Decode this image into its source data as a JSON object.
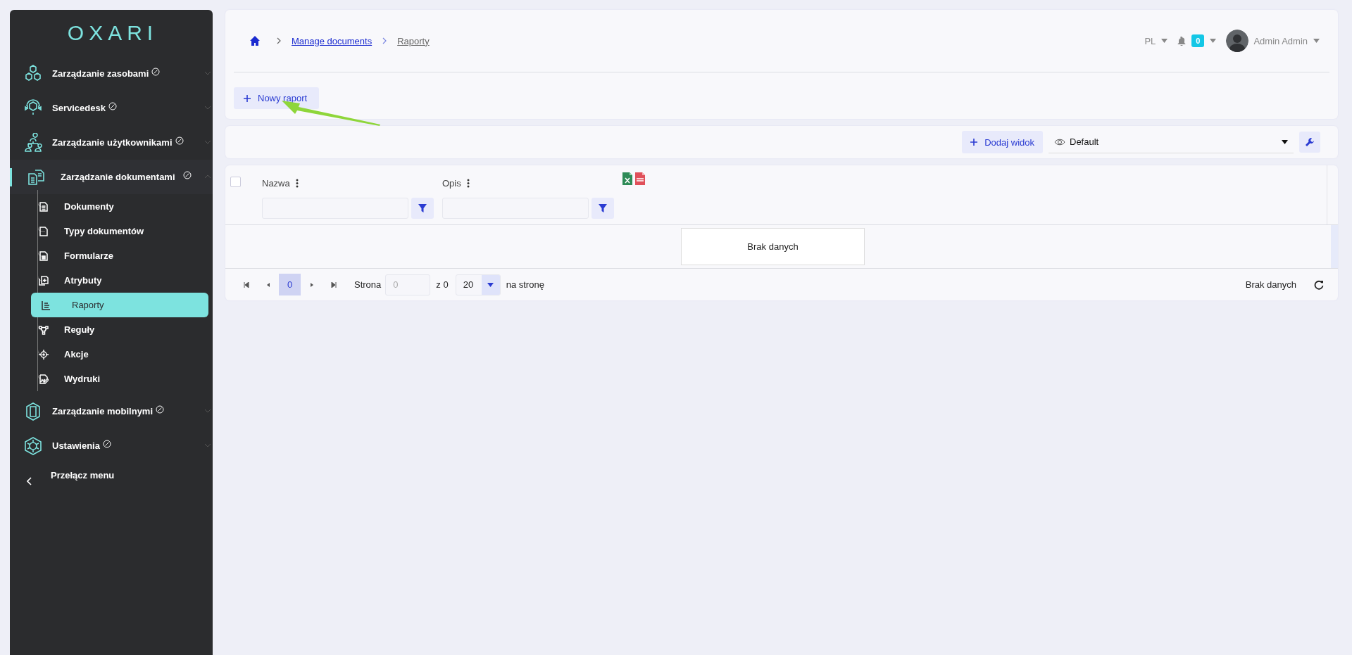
{
  "sidebar": {
    "logo": "OXARI",
    "items": [
      {
        "label": "Zarządzanie zasobami",
        "selected": false,
        "expanded": false
      },
      {
        "label": "Servicedesk",
        "selected": false,
        "expanded": false
      },
      {
        "label": "Zarządzanie użytkownikami",
        "selected": false,
        "expanded": false
      },
      {
        "label": "Zarządzanie dokumentami",
        "selected": true,
        "expanded": true,
        "children": [
          {
            "label": "Dokumenty",
            "selected": false
          },
          {
            "label": "Typy dokumentów",
            "selected": false
          },
          {
            "label": "Formularze",
            "selected": false
          },
          {
            "label": "Atrybuty",
            "selected": false
          },
          {
            "label": "Raporty",
            "selected": true
          },
          {
            "label": "Reguły",
            "selected": false
          },
          {
            "label": "Akcje",
            "selected": false
          },
          {
            "label": "Wydruki",
            "selected": false
          }
        ]
      },
      {
        "label": "Zarządzanie mobilnymi",
        "selected": false,
        "expanded": false
      },
      {
        "label": "Ustawienia",
        "selected": false,
        "expanded": false
      }
    ],
    "toggle": "Przełącz menu"
  },
  "header": {
    "breadcrumb": [
      {
        "label": "Manage documents",
        "kind": "link"
      },
      {
        "label": "Raporty",
        "kind": "current"
      }
    ],
    "language": "PL",
    "notifications": "0",
    "user": "Admin Admin"
  },
  "actions": {
    "new_button": "Nowy raport"
  },
  "toolbar": {
    "add_view": "Dodaj widok",
    "view": "Default"
  },
  "table": {
    "select_all": {
      "checked": false
    },
    "columns": [
      {
        "label": "Nazwa"
      },
      {
        "label": "Opis"
      }
    ],
    "empty": "Brak danych"
  },
  "pagination": {
    "current_page": "0",
    "page_label": "Strona",
    "page_input": {
      "placeholder": "0"
    },
    "of": "z 0",
    "per_page": "20",
    "per_page_label": "na stronę",
    "status": "Brak danych"
  }
}
